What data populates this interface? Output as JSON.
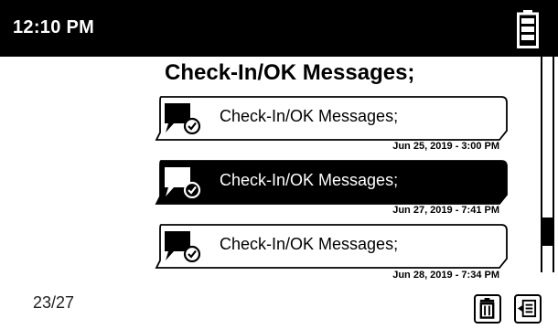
{
  "status_bar": {
    "time": "12:10 PM",
    "battery_icon": "battery-full-icon"
  },
  "screen": {
    "title": "Check-In/OK Messages;"
  },
  "messages": [
    {
      "text": "Check-In/OK Messages;",
      "date": "Jun 25, 2019 - 3:00 PM",
      "selected": false,
      "icon": "message-check-icon"
    },
    {
      "text": "Check-In/OK Messages;",
      "date": "Jun 27, 2019 - 7:41 PM",
      "selected": true,
      "icon": "message-check-icon"
    },
    {
      "text": "Check-In/OK Messages;",
      "date": "Jun 28, 2019 - 7:34 PM",
      "selected": false,
      "icon": "message-check-icon"
    }
  ],
  "scroll": {
    "position_fraction": 0.86,
    "visible_fraction": 0.13
  },
  "footer": {
    "page_counter": "23/27",
    "delete_icon": "trash-icon",
    "menu_icon": "list-menu-icon"
  },
  "colors": {
    "bar_background": "#000000",
    "bar_text": "#ffffff",
    "selected_background": "#000000",
    "selected_text": "#ffffff"
  }
}
